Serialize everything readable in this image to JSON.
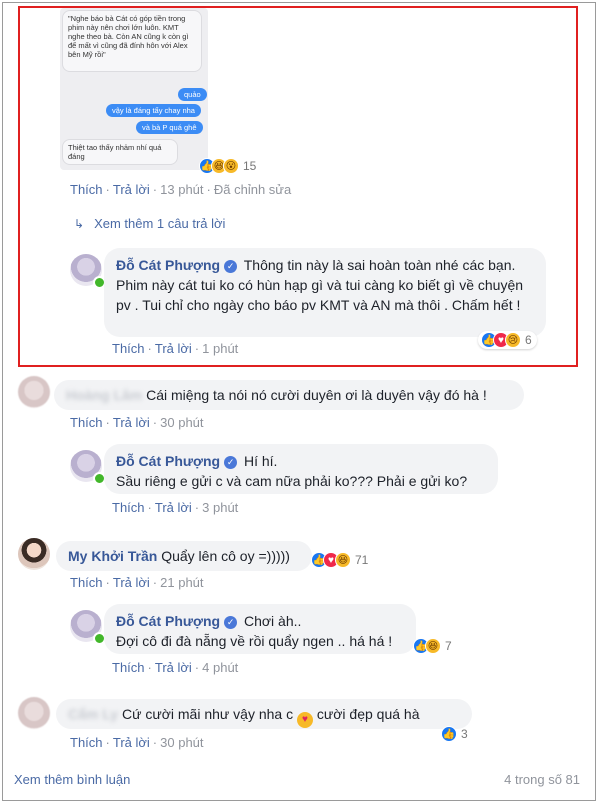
{
  "chat_snippet": {
    "gray1": "\"Nghe báo bà Cát có góp tiền trong phim này nên chơi lớn luôn. KMT nghe theo bà. Còn AN cũng k còn gì để mất vì cũng đã đính hôn với Alex bên Mỹ rồi\"",
    "blue1": "quảo",
    "blue2": "vậy là đáng tẩy chay nha",
    "blue3": "và bà P quá ghê",
    "gray2": "Thiệt tao thấy nhảm nhí quá đáng"
  },
  "top_comment": {
    "reactions": [
      "like-icon",
      "haha-icon",
      "wow-icon"
    ],
    "reaction_count": "15",
    "like": "Thích",
    "reply": "Trả lời",
    "time": "13 phút",
    "edited": "Đã chỉnh sửa"
  },
  "see_more_replies": "Xem thêm 1 câu trả lời",
  "comments": [
    {
      "name": "Đỗ Cát Phượng",
      "text": "Thông tin này là sai hoàn toàn nhé các bạn. Phim này cát tui ko có hùn hạp gì và tui càng ko biết gì về chuyện pv . Tui chỉ cho ngày cho báo pv KMT và AN mà thôi . Chấm hết !",
      "like": "Thích",
      "reply": "Trả lời",
      "time": "1 phút",
      "reaction_count": "6"
    },
    {
      "name": "Hoàng Lâm",
      "text": "Cái miệng ta nói nó cười duyên ơi là duyên vậy đó hà !",
      "like": "Thích",
      "reply": "Trả lời",
      "time": "30 phút"
    },
    {
      "name": "Đỗ Cát Phượng",
      "line1": "Hí hí.",
      "line2": "Sầu riêng e gửi c và cam nữa phải ko??? Phải e gửi ko?",
      "like": "Thích",
      "reply": "Trả lời",
      "time": "3 phút"
    },
    {
      "name": "My Khởi Trần",
      "text": "Quẩy lên cô oy =)))))",
      "like": "Thích",
      "reply": "Trả lời",
      "time": "21 phút",
      "reaction_count": "71"
    },
    {
      "name": "Đỗ Cát Phượng",
      "line1": "Chơi àh..",
      "line2": "Đợi cô đi đà nẵng về rồi quẩy ngen .. há há !",
      "like": "Thích",
      "reply": "Trả lời",
      "time": "4 phút",
      "reaction_count": "7"
    },
    {
      "name": "Cẩm Ly",
      "text_a": "Cứ cười mãi như vậy nha c",
      "text_b": "cười đẹp quá hà",
      "like": "Thích",
      "reply": "Trả lời",
      "time": "30 phút",
      "reaction_count": "3"
    }
  ],
  "footer": {
    "view_more": "Xem thêm bình luận",
    "counter": "4 trong số 81"
  }
}
